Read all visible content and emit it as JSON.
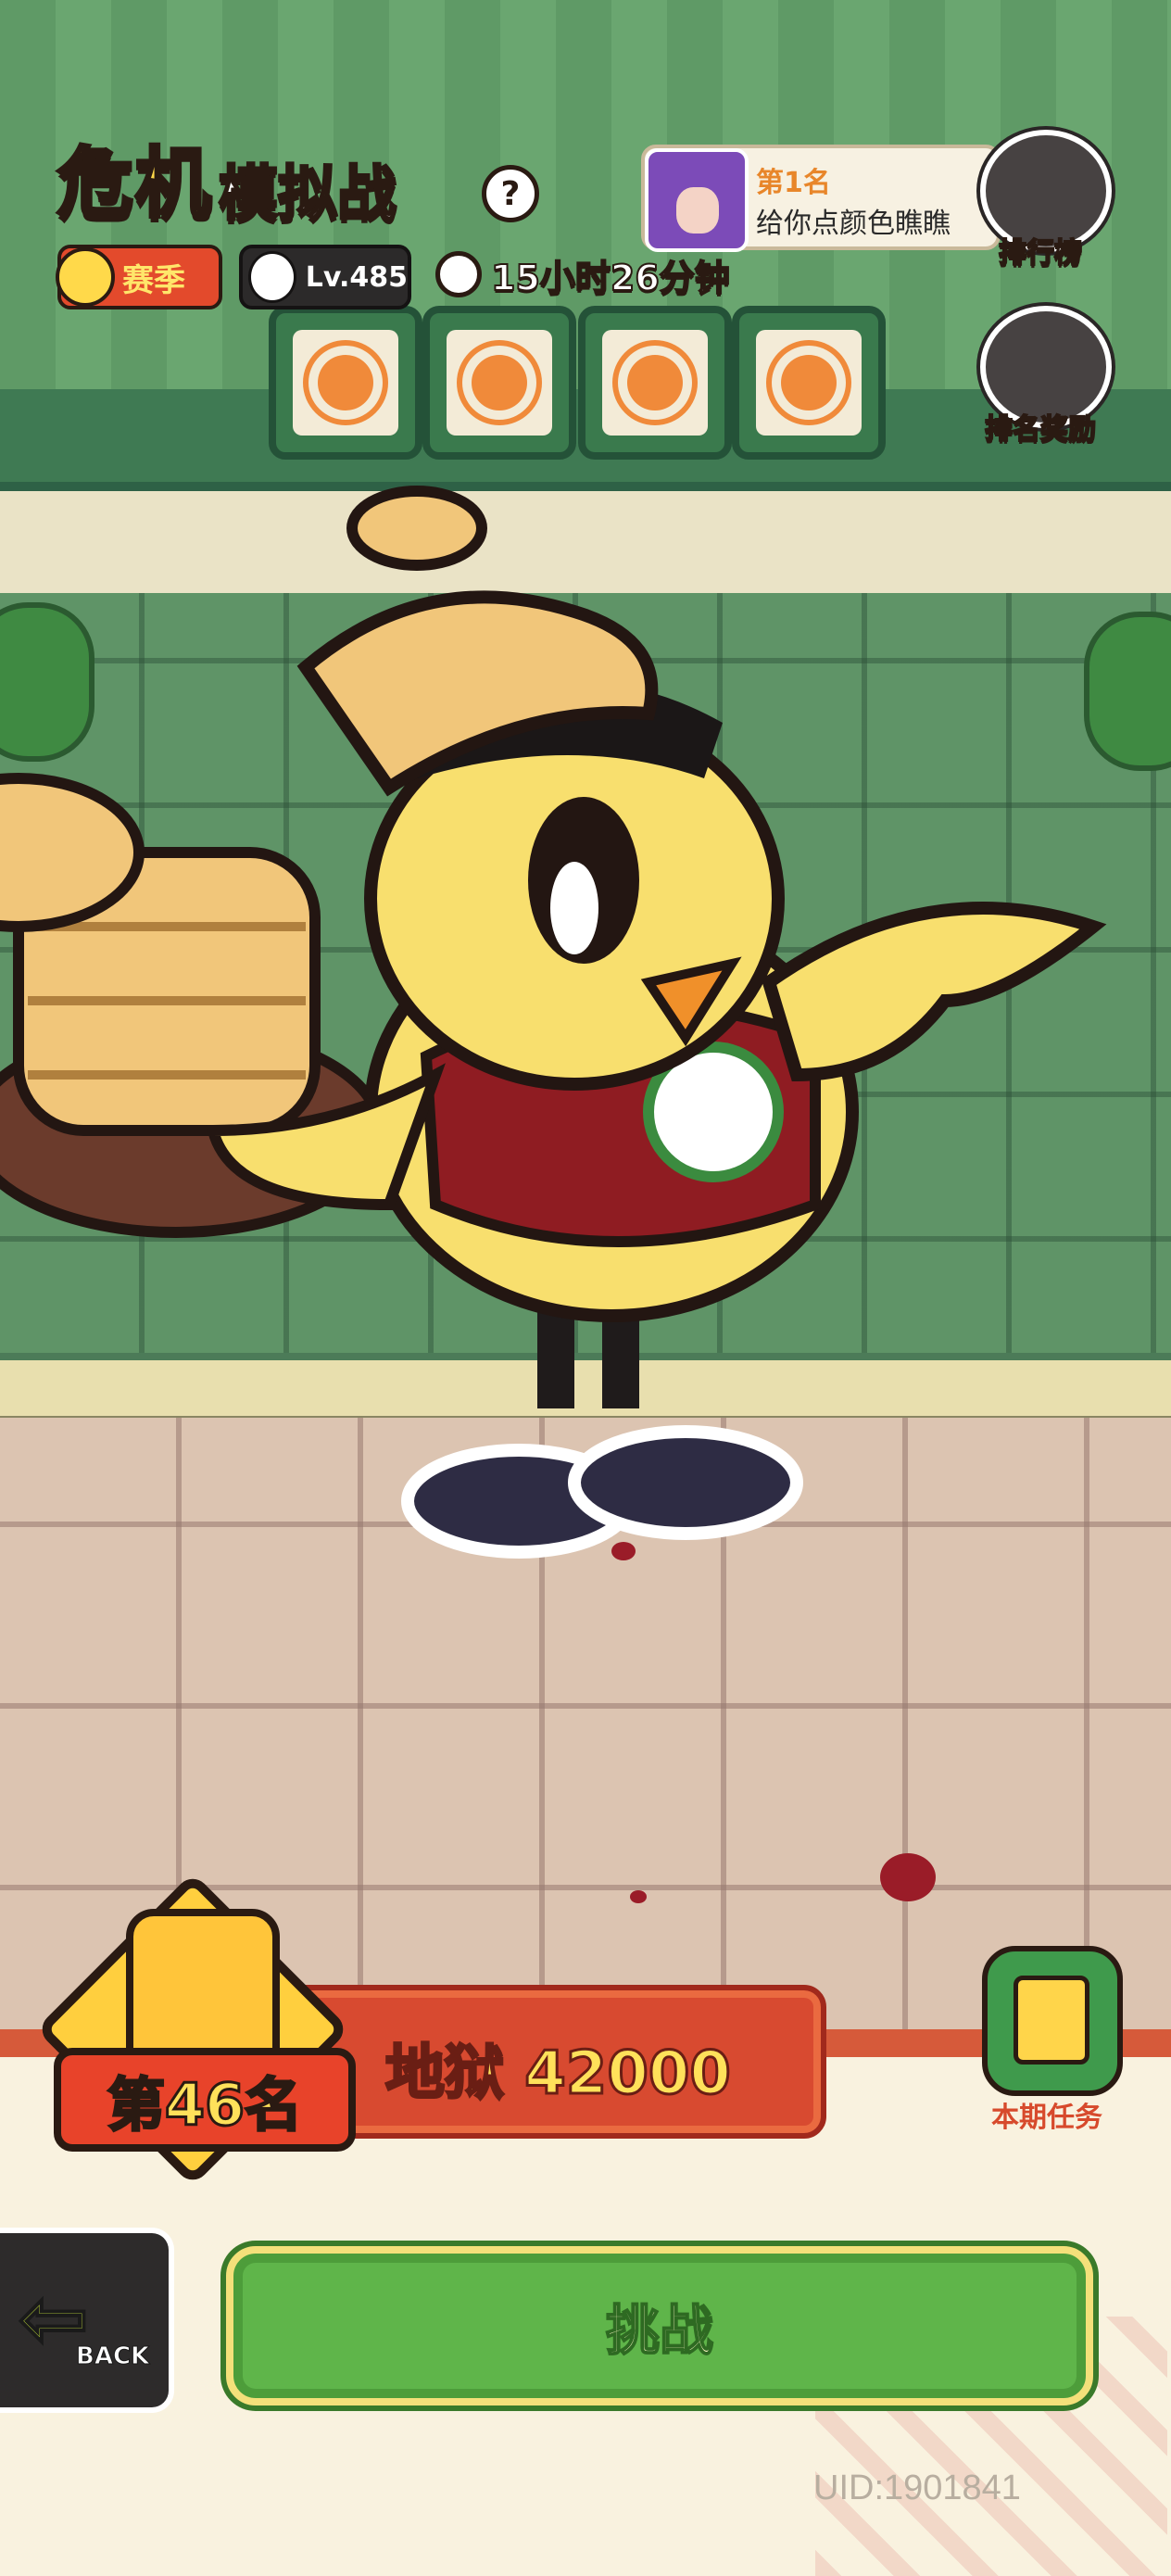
{
  "header": {
    "title_highlight": "危机",
    "title_rest": "模拟战",
    "help_symbol": "?",
    "season_label": "赛季",
    "level": "Lv.485",
    "time_remaining": "15小时26分钟"
  },
  "top_player": {
    "rank_label": "第1名",
    "name": "给你点颜色瞧瞧"
  },
  "side_buttons": {
    "leaderboard": "排行榜",
    "rank_rewards": "排名奖励"
  },
  "score": {
    "rank": "第46名",
    "text": "地狱 42000"
  },
  "tasks": {
    "label": "本期任务"
  },
  "back": {
    "label": "BACK"
  },
  "challenge": {
    "label": "挑战"
  },
  "uid": "UID:1901841",
  "colors": {
    "accent_yellow": "#ffd84a",
    "score_red": "#d84a30",
    "challenge_green": "#5fb54a",
    "panel_cream": "#f9f2df"
  },
  "icons": {
    "help": "question-icon",
    "clock": "clock-icon",
    "trophy": "trophy-icon",
    "reward": "reward-icon",
    "task": "scroll-icon",
    "back": "arrow-left-icon",
    "rank_emblem": "fist-icon"
  }
}
